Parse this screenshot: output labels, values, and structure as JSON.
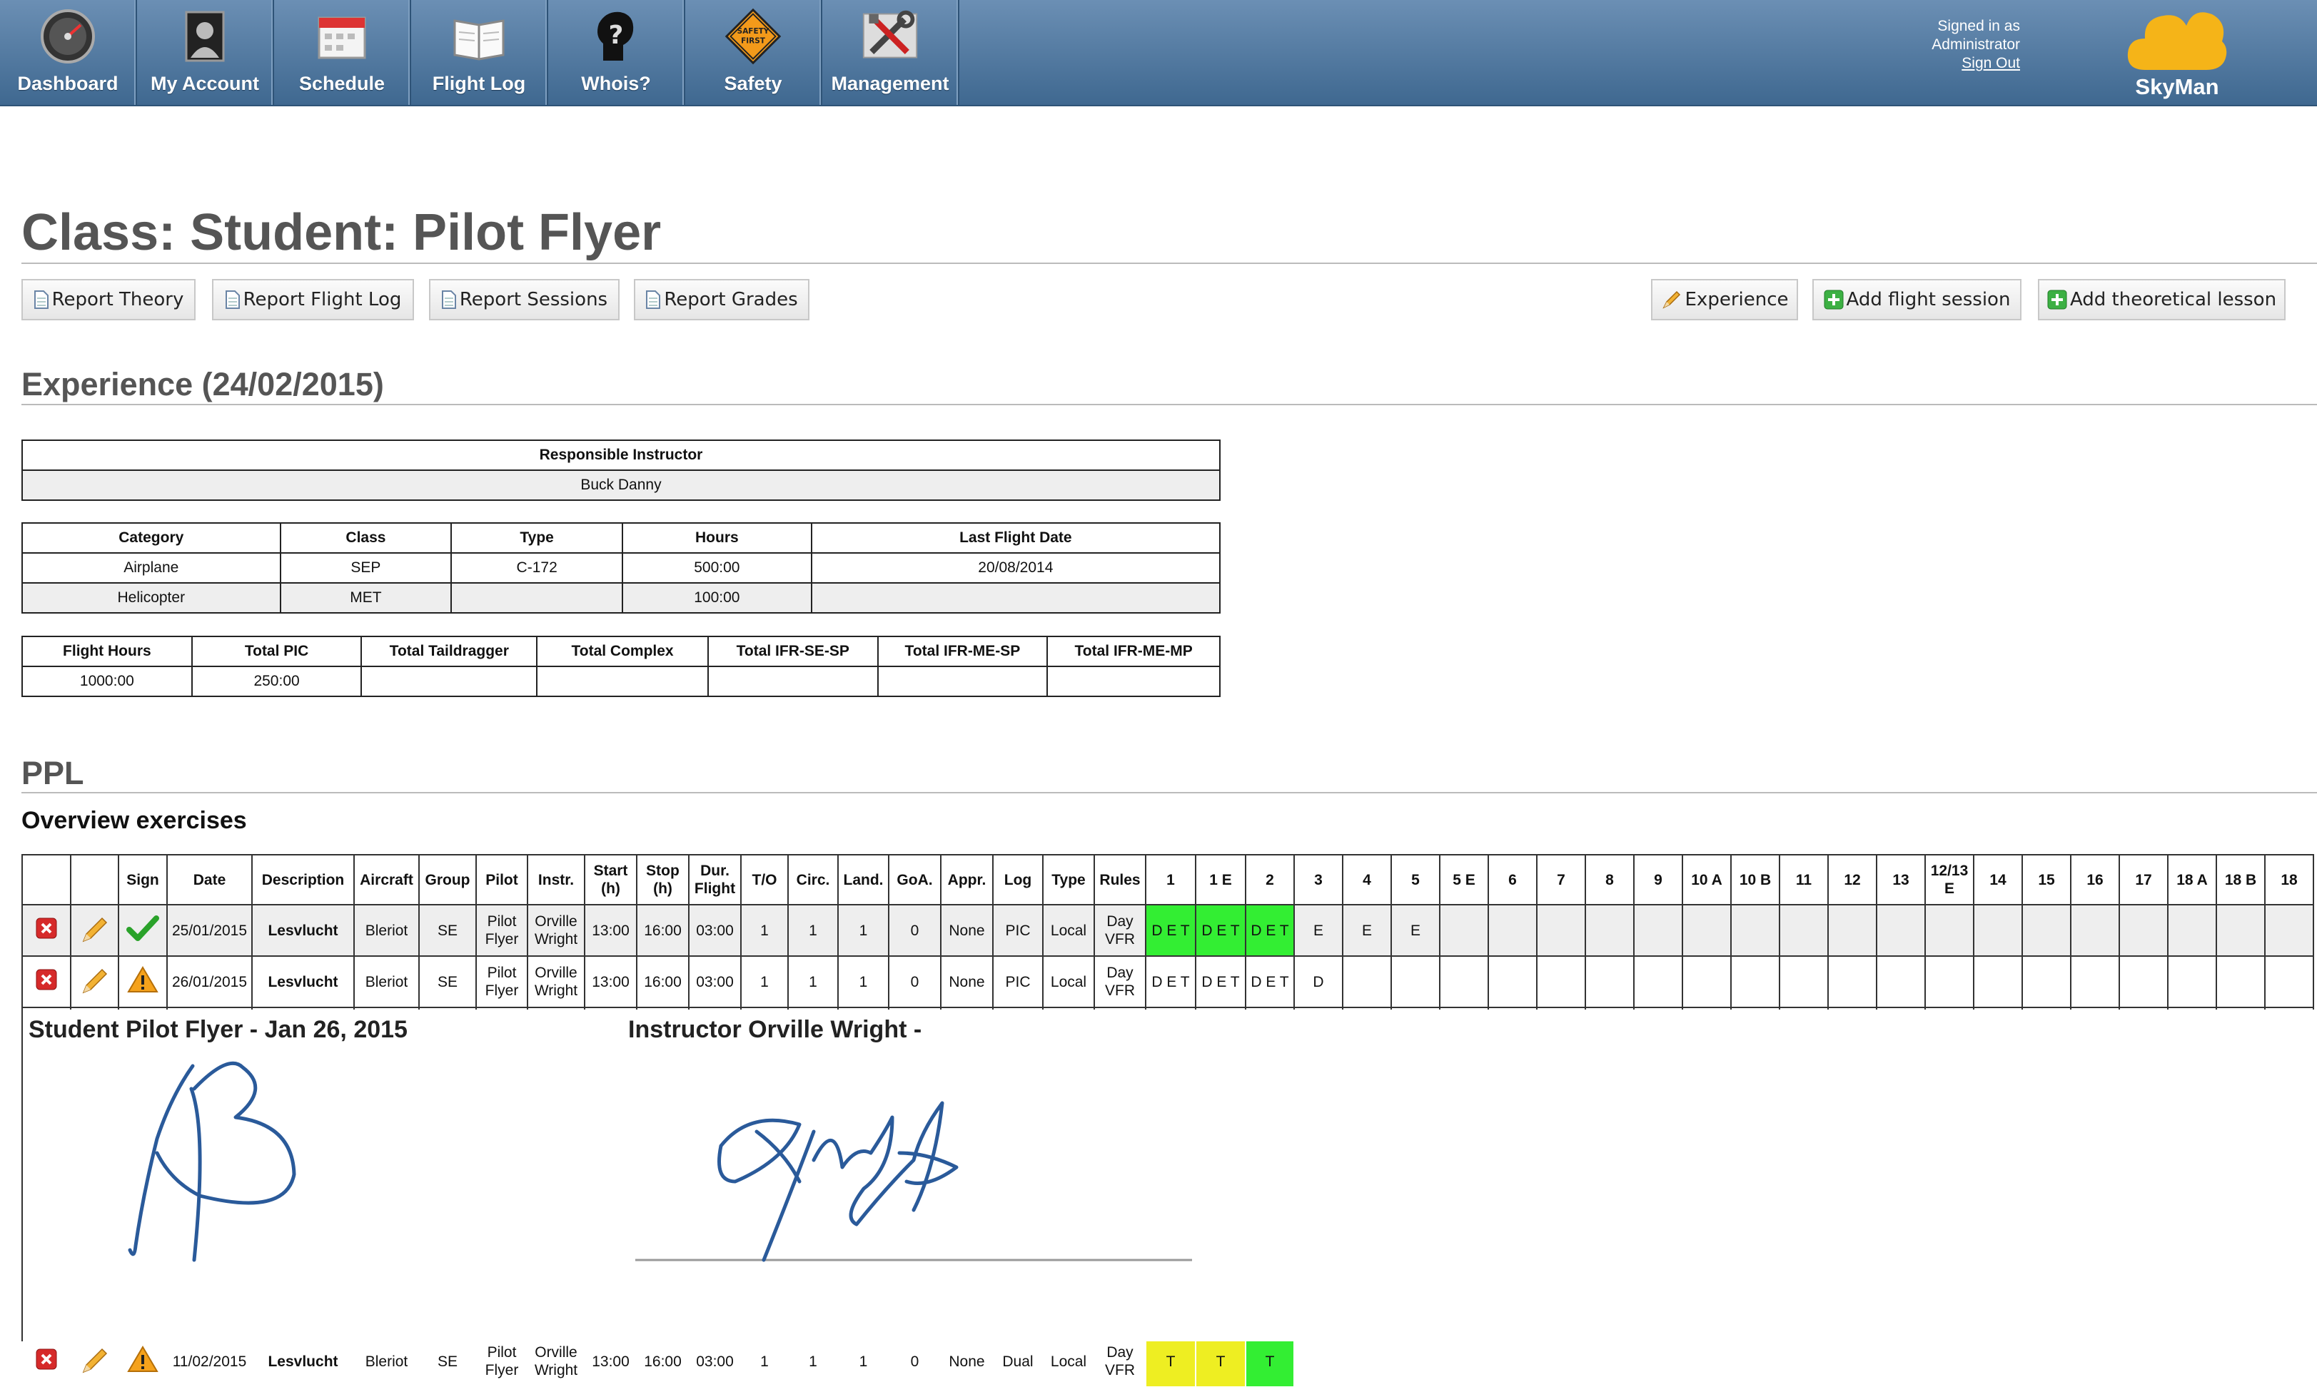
{
  "nav": {
    "items": [
      {
        "label": "Dashboard",
        "icon": "dashboard-gauge-icon"
      },
      {
        "label": "My Account",
        "icon": "account-person-icon"
      },
      {
        "label": "Schedule",
        "icon": "calendar-icon"
      },
      {
        "label": "Flight Log",
        "icon": "logbook-icon"
      },
      {
        "label": "Whois?",
        "icon": "question-head-icon"
      },
      {
        "label": "Safety",
        "icon": "safety-first-sign-icon",
        "sign_text": "SAFETY FIRST"
      },
      {
        "label": "Management",
        "icon": "tools-icon"
      }
    ],
    "signed_in_line1": "Signed in as",
    "signed_in_user": "Administrator",
    "sign_out": "Sign Out",
    "brand": "SkyMan"
  },
  "page": {
    "title": "Class: Student: Pilot Flyer",
    "buttons_left": [
      "Report Theory",
      "Report Flight Log",
      "Report Sessions",
      "Report Grades"
    ],
    "buttons_right": [
      "Experience",
      "Add flight session",
      "Add theoretical lesson"
    ]
  },
  "experience": {
    "title": "Experience (24/02/2015)",
    "instructor_header": "Responsible Instructor",
    "instructor": "Buck Danny",
    "aircraft_headers": [
      "Category",
      "Class",
      "Type",
      "Hours",
      "Last Flight Date"
    ],
    "aircraft_rows": [
      [
        "Airplane",
        "SEP",
        "C-172",
        "500:00",
        "20/08/2014"
      ],
      [
        "Helicopter",
        "MET",
        "",
        "100:00",
        ""
      ]
    ],
    "totals_headers": [
      "Flight Hours",
      "Total PIC",
      "Total Taildragger",
      "Total Complex",
      "Total IFR-SE-SP",
      "Total IFR-ME-SP",
      "Total IFR-ME-MP"
    ],
    "totals_row": [
      "1000:00",
      "250:00",
      "",
      "",
      "",
      "",
      ""
    ]
  },
  "ppl": {
    "title": "PPL",
    "overview_title": "Overview exercises",
    "headers": [
      "",
      "",
      "Sign",
      "Date",
      "Description",
      "Aircraft",
      "Group",
      "Pilot",
      "Instr.",
      "Start (h)",
      "Stop (h)",
      "Dur. Flight",
      "T/O",
      "Circ.",
      "Land.",
      "GoA.",
      "Appr.",
      "Log",
      "Type",
      "Rules",
      "1",
      "1 E",
      "2",
      "3",
      "4",
      "5",
      "5 E",
      "6",
      "7",
      "8",
      "9",
      "10 A",
      "10 B",
      "11",
      "12",
      "13",
      "12/13 E",
      "14",
      "15",
      "16",
      "17",
      "18 A",
      "18 B",
      "18"
    ],
    "rows": [
      {
        "sign_icon": "check-icon",
        "cells": [
          "25/01/2015",
          "Lesvlucht",
          "Bleriot",
          "SE",
          "Pilot Flyer",
          "Orville Wright",
          "13:00",
          "16:00",
          "03:00",
          "1",
          "1",
          "1",
          "0",
          "None",
          "PIC",
          "Local",
          "Day VFR"
        ],
        "exercises": [
          {
            "v": "D E T",
            "c": "g"
          },
          {
            "v": "D E T",
            "c": "g"
          },
          {
            "v": "D E T",
            "c": "g"
          },
          {
            "v": "E",
            "c": ""
          },
          {
            "v": "E",
            "c": ""
          },
          {
            "v": "E",
            "c": ""
          }
        ]
      },
      {
        "sign_icon": "warning-icon",
        "cells": [
          "26/01/2015",
          "Lesvlucht",
          "Bleriot",
          "SE",
          "Pilot Flyer",
          "Orville Wright",
          "13:00",
          "16:00",
          "03:00",
          "1",
          "1",
          "1",
          "0",
          "None",
          "PIC",
          "Local",
          "Day VFR"
        ],
        "exercises": [
          {
            "v": "D E T",
            "c": ""
          },
          {
            "v": "D E T",
            "c": ""
          },
          {
            "v": "D E T",
            "c": ""
          },
          {
            "v": "D",
            "c": ""
          }
        ]
      },
      {
        "sign_icon": "warning-icon",
        "cells": [
          "11/02/2015",
          "Lesvlucht",
          "Bleriot",
          "SE",
          "Pilot Flyer",
          "Orville Wright",
          "13:00",
          "16:00",
          "03:00",
          "1",
          "1",
          "1",
          "0",
          "None",
          "Dual",
          "Local",
          "Day VFR"
        ],
        "exercises": [
          {
            "v": "T",
            "c": "y"
          },
          {
            "v": "T",
            "c": "y"
          },
          {
            "v": "T",
            "c": "g"
          }
        ]
      }
    ],
    "signatures": {
      "student_title": "Student Pilot Flyer - Jan 26, 2015",
      "instructor_title": "Instructor Orville Wright -"
    }
  },
  "colors": {
    "nav_top": "#6b8fb4",
    "nav_bottom": "#3f6890",
    "done_green": "#33ee33",
    "pending_yellow": "#eeee22",
    "brand_cloud": "#f5b418"
  }
}
